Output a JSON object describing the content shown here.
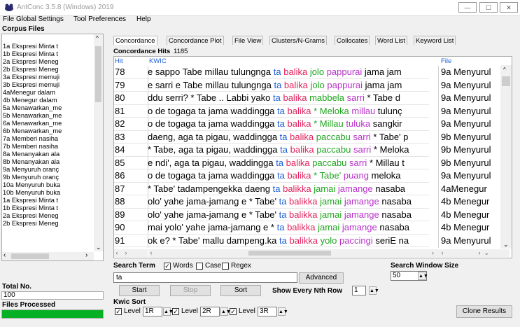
{
  "window": {
    "title": "AntConc 3.5.8 (Windows) 2019",
    "min": "—",
    "max": "☐",
    "close": "✕"
  },
  "menu": [
    "File",
    "Global Settings",
    "Tool Preferences",
    "Help"
  ],
  "left": {
    "title": "Corpus Files",
    "files": [
      "1a Ekspresi Minta t",
      "1b Ekspresi Minta t",
      "2a Ekspresi Meneg",
      "2b Ekspresi Meneg",
      "3a Ekspresi memuji",
      "3b Ekspresi memuji",
      "4aMenegur dalam",
      "4b Menegur dalam",
      "5a Menawarkan_me",
      "5b Menawarkan_me",
      "6a Menawarkan_me",
      "6b Menawarkan_me",
      "7a Memberi nasiha",
      "7b Memberi nasiha",
      "8a Menanyakan ala",
      "8b Menanyakan ala",
      "9a Menyuruh oranç",
      "9b Menyuruh oranç",
      "10a Menyuruh buka",
      "10b Menyuruh buka",
      "1a Ekspresi Minta t",
      "1b Ekspresi Minta t",
      "2a Ekspresi Meneg",
      "2b Ekspresi Meneg"
    ],
    "total_label": "Total No.",
    "total_value": "100",
    "processed_label": "Files Processed",
    "progress": 1.0,
    "progress_color": "#06b025"
  },
  "tabs": [
    "Concordance",
    "Concordance Plot",
    "File View",
    "Clusters/N-Grams",
    "Collocates",
    "Word List",
    "Keyword List"
  ],
  "hits": {
    "label": "Concordance Hits",
    "value": "1185"
  },
  "columns": {
    "hit": "Hit",
    "kwic": "KWIC",
    "file": "File"
  },
  "colors": {
    "ta": "#1d5fd6",
    "balika": "#e0245e",
    "green": "#20a520",
    "purple": "#b833c8",
    "header": "#1d5fd6"
  },
  "rows": [
    {
      "hit": "78",
      "left": "e sappo Tabe millau tulungnga",
      "node": "ta",
      "n1": "balika",
      "n2": "jolo",
      "n3": "pappurai",
      "rest": "jama jam",
      "file": "9a Menyurul"
    },
    {
      "hit": "79",
      "left": "e sarri e Tabe millau tulungnga",
      "node": "ta",
      "n1": "balika",
      "n2": "jolo",
      "n3": "pappurai",
      "rest": "jama jam",
      "file": "9a Menyurul"
    },
    {
      "hit": "80",
      "left": "ddu serri? * Tabe .. Labbi yako",
      "node": "ta",
      "n1": "balika",
      "n2": "mabbela",
      "n3": "sarri",
      "rest": "* Tabe d",
      "file": "9a Menyurul"
    },
    {
      "hit": "81",
      "left": "o de togaga ta jama waddingga",
      "node": "ta",
      "n1": "balika",
      "n2": "* Meloka",
      "n3": "millau",
      "rest": "tulunç",
      "file": "9a Menyurul"
    },
    {
      "hit": "82",
      "left": "o de togaga ta jama waddingga",
      "node": "ta",
      "n1": "balika",
      "n2": "* Millau",
      "n3": "tuluka",
      "rest": "sangkir",
      "file": "9a Menyurul"
    },
    {
      "hit": "83",
      "left": "daeng, aga ta pigau, waddingga",
      "node": "ta",
      "n1": "balika",
      "n2": "paccabu",
      "n3": "sarri",
      "rest": "* Tabe' p",
      "file": "9b Menyurul"
    },
    {
      "hit": "84",
      "left": "* Tabe, aga ta pigau, waddingga",
      "node": "ta",
      "n1": "balika",
      "n2": "paccabu",
      "n3": "sarri",
      "rest": "* Meloka",
      "file": "9b Menyurul"
    },
    {
      "hit": "85",
      "left": "e ndi', aga ta pigau, waddingga",
      "node": "ta",
      "n1": "balika",
      "n2": "paccabu",
      "n3": "sarri",
      "rest": "* Millau t",
      "file": "9b Menyurul"
    },
    {
      "hit": "86",
      "left": "o de togaga ta jama waddingga",
      "node": "ta",
      "n1": "balika",
      "n2": "* Tabe'",
      "n3": "puang",
      "rest": "meloka",
      "file": "9a Menyurul"
    },
    {
      "hit": "87",
      "left": "* Tabe' tadampengekka daeng",
      "node": "ta",
      "n1": "balikka",
      "n2": "jamai",
      "n3": "jamange",
      "rest": "nasaba",
      "file": "4aMenegur"
    },
    {
      "hit": "88",
      "left": "olo' yahe jama-jamang e * Tabe'",
      "node": "ta",
      "n1": "balikka",
      "n2": "jamai",
      "n3": "jamange",
      "rest": "nasaba",
      "file": "4b Menegur"
    },
    {
      "hit": "89",
      "left": "olo' yahe jama-jamang e * Tabe'",
      "node": "ta",
      "n1": "balikka",
      "n2": "jamai",
      "n3": "jamange",
      "rest": "nasaba",
      "file": "4b Menegur"
    },
    {
      "hit": "90",
      "left": "mai yolo' yahe jama-jamang e *",
      "node": "ta",
      "n1": "balikka",
      "n2": "jamai",
      "n3": "jamange",
      "rest": "nasaba",
      "file": "4b Menegur"
    },
    {
      "hit": "91",
      "left": "ok e? * Tabe' mallu dampeng.ka",
      "node": "ta",
      "n1": "balikka",
      "n2": "yolo",
      "n3": "paccingi",
      "rest": "seriE na",
      "file": "9a Menyurul"
    }
  ],
  "search": {
    "label": "Search Term",
    "words": "Words",
    "case": "Case",
    "regex": "Regex",
    "value": "ta",
    "advanced": "Advanced",
    "start": "Start",
    "stop": "Stop",
    "sort": "Sort",
    "nth_label": "Show Every Nth Row",
    "nth_value": "1",
    "window_label": "Search Window Size",
    "window_value": "50"
  },
  "kwic_sort": {
    "label": "Kwic Sort",
    "level1": "Level 1",
    "level1_value": "1R",
    "level2": "Level 2",
    "level2_value": "2R",
    "level3": "Level 3",
    "level3_value": "3R",
    "clone": "Clone Results"
  }
}
